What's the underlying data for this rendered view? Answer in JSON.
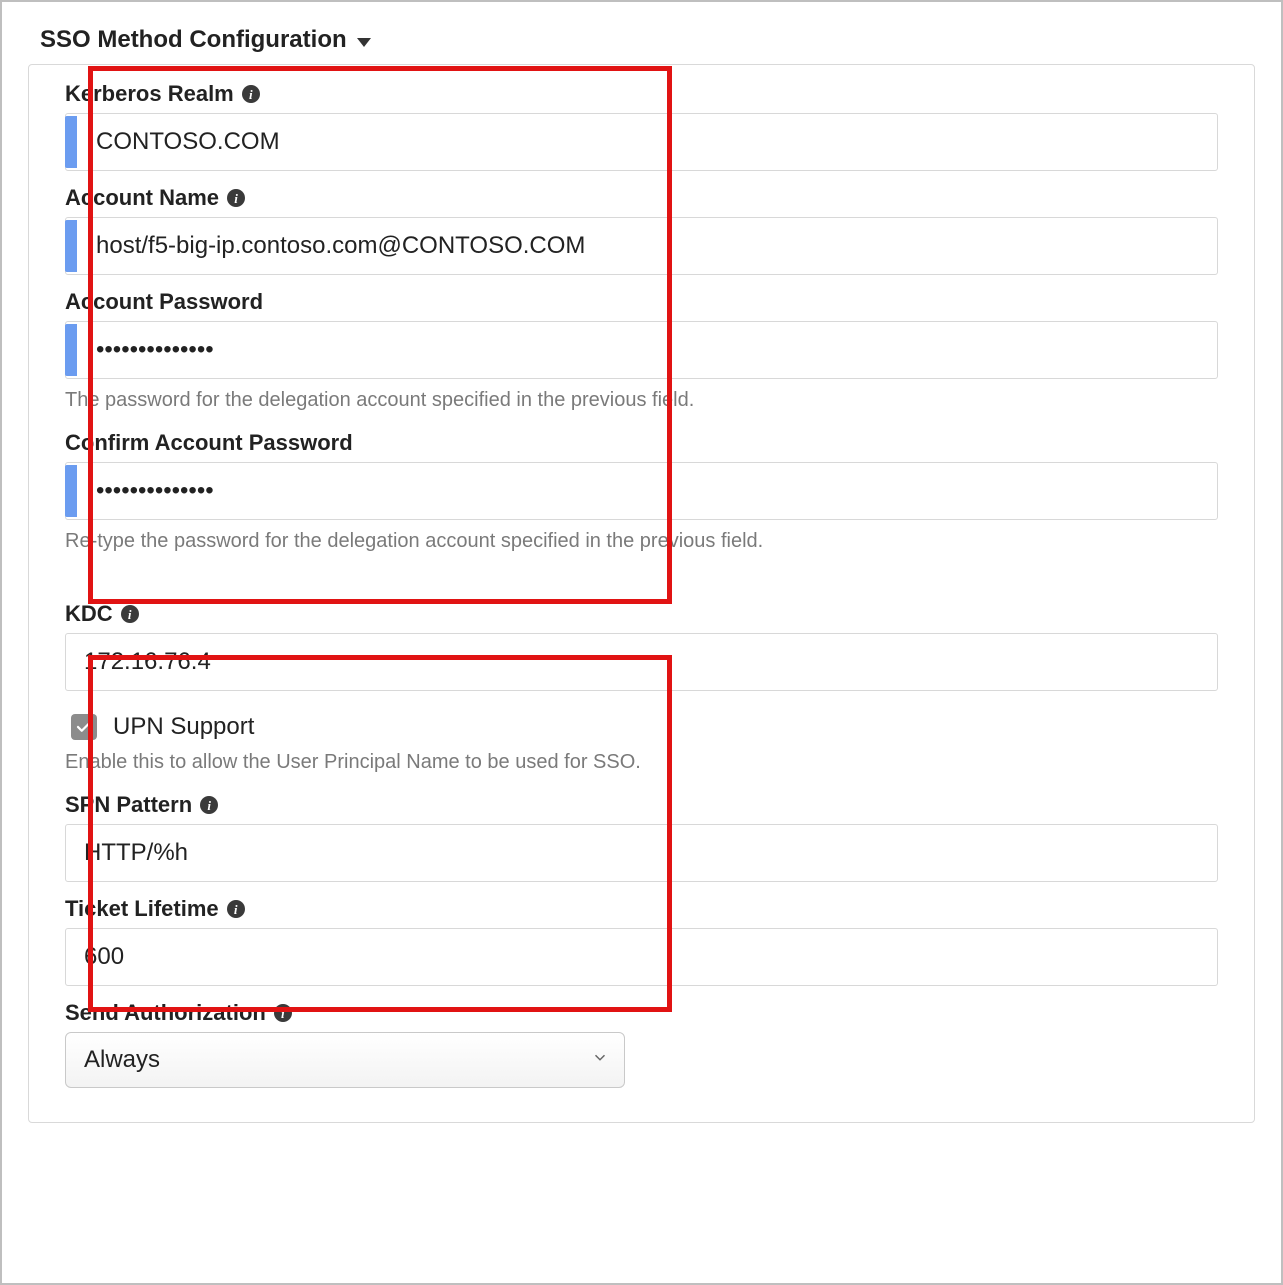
{
  "section": {
    "title": "SSO Method Configuration"
  },
  "fields": {
    "kerberos_realm": {
      "label": "Kerberos Realm",
      "value": "CONTOSO.COM"
    },
    "account_name": {
      "label": "Account Name",
      "value": "host/f5-big-ip.contoso.com@CONTOSO.COM"
    },
    "account_password": {
      "label": "Account Password",
      "value": "••••••••••••••",
      "help": "The password for the delegation account specified in the previous field."
    },
    "confirm_password": {
      "label": "Confirm Account Password",
      "value": "••••••••••••••",
      "help": "Re-type the password for the delegation account specified in the previous field."
    },
    "kdc": {
      "label": "KDC",
      "value": "172.16.76.4"
    },
    "upn_support": {
      "label": "UPN Support",
      "checked": true,
      "help": "Enable this to allow the User Principal Name to be used for SSO."
    },
    "spn_pattern": {
      "label": "SPN Pattern",
      "value": "HTTP/%h"
    },
    "ticket_lifetime": {
      "label": "Ticket Lifetime",
      "value": "600"
    },
    "send_authorization": {
      "label": "Send Authorization",
      "value": "Always"
    }
  }
}
